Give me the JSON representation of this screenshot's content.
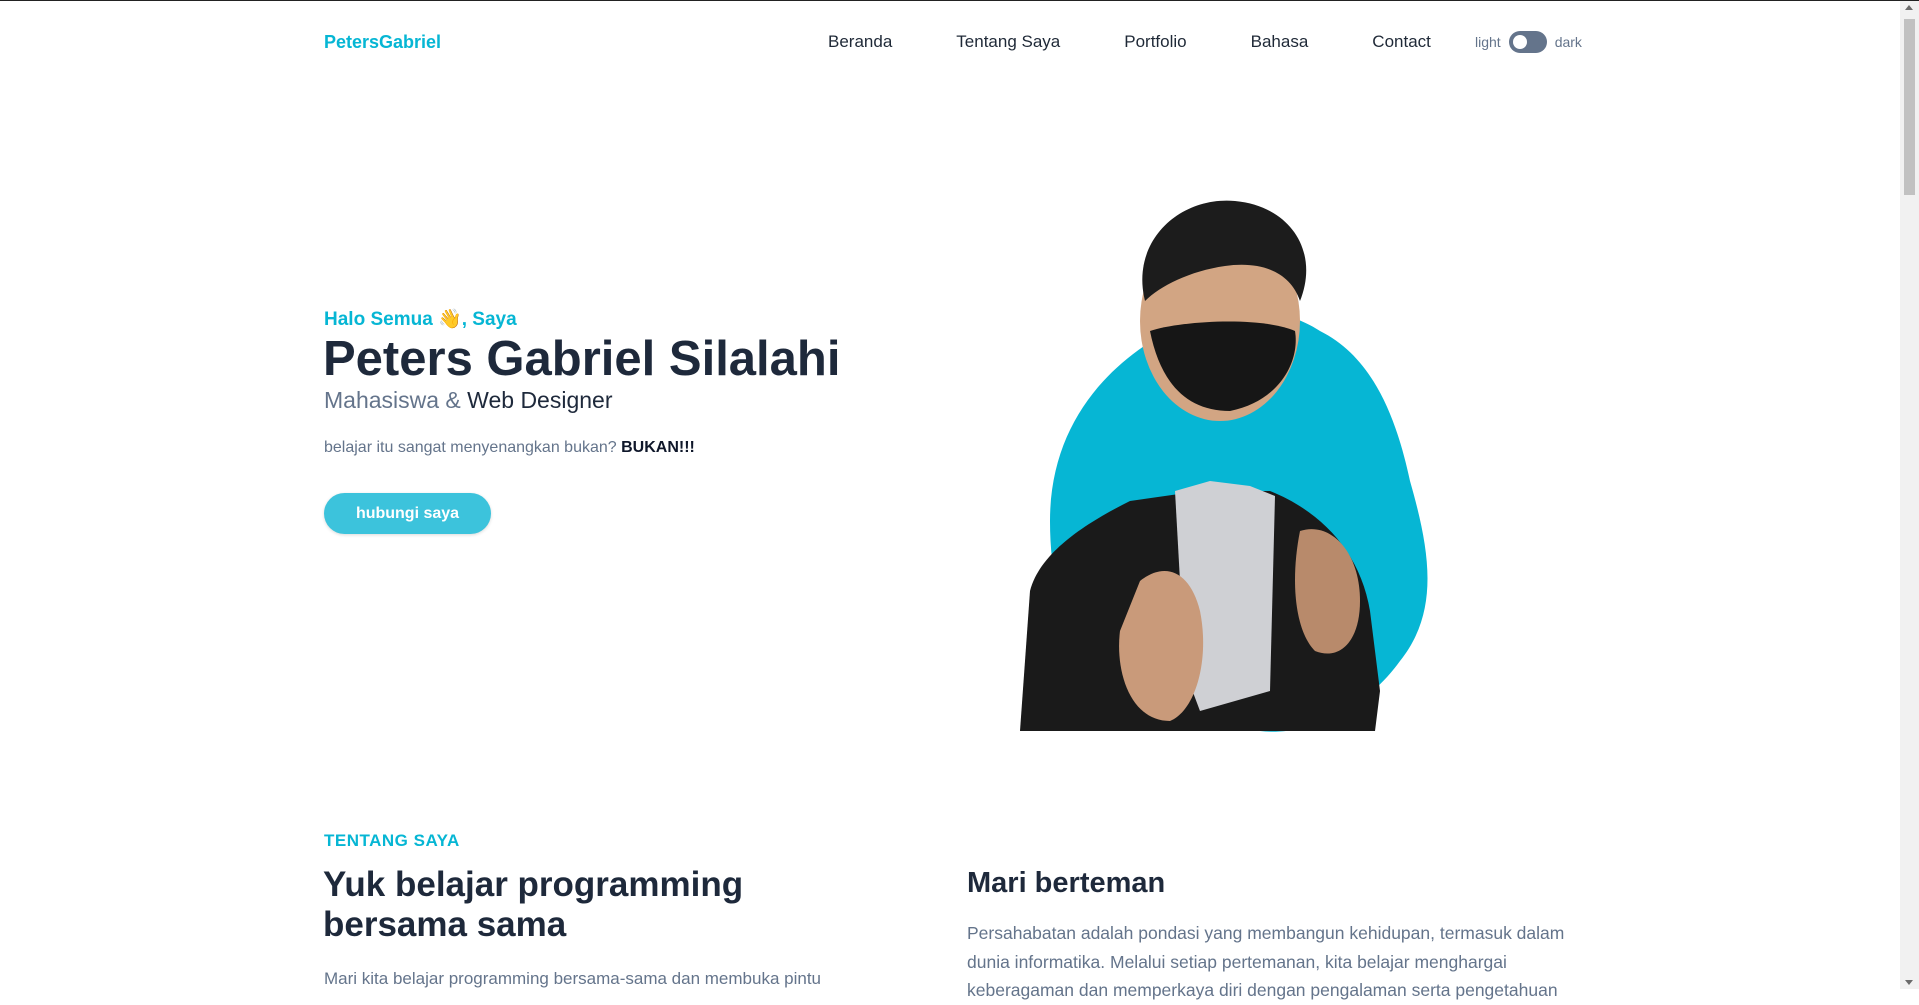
{
  "header": {
    "brand": "PetersGabriel",
    "nav": [
      "Beranda",
      "Tentang Saya",
      "Portfolio",
      "Bahasa",
      "Contact"
    ],
    "theme_light": "light",
    "theme_dark": "dark"
  },
  "hero": {
    "greeting_prefix": "Halo Semua ",
    "greeting_emoji": "👋",
    "greeting_suffix": ", Saya",
    "name": "Peters Gabriel Silalahi",
    "role_prefix": "Mahasiswa & ",
    "role_strong": "Web Designer",
    "tagline": "belajar itu sangat menyenangkan bukan?",
    "tagline_bold": "BUKAN!!!",
    "cta_label": "hubungi saya"
  },
  "about": {
    "label": "TENTANG SAYA",
    "title": "Yuk belajar programming bersama sama",
    "text": "Mari kita belajar programming bersama-sama dan membuka pintu",
    "friend_title": "Mari berteman",
    "friend_text": "Persahabatan adalah pondasi yang membangun kehidupan, termasuk dalam dunia informatika. Melalui setiap pertemanan, kita belajar menghargai keberagaman dan memperkaya diri dengan pengalaman serta pengetahuan"
  },
  "colors": {
    "accent": "#06b6d4",
    "heading": "#1e293b",
    "muted": "#64748b"
  }
}
